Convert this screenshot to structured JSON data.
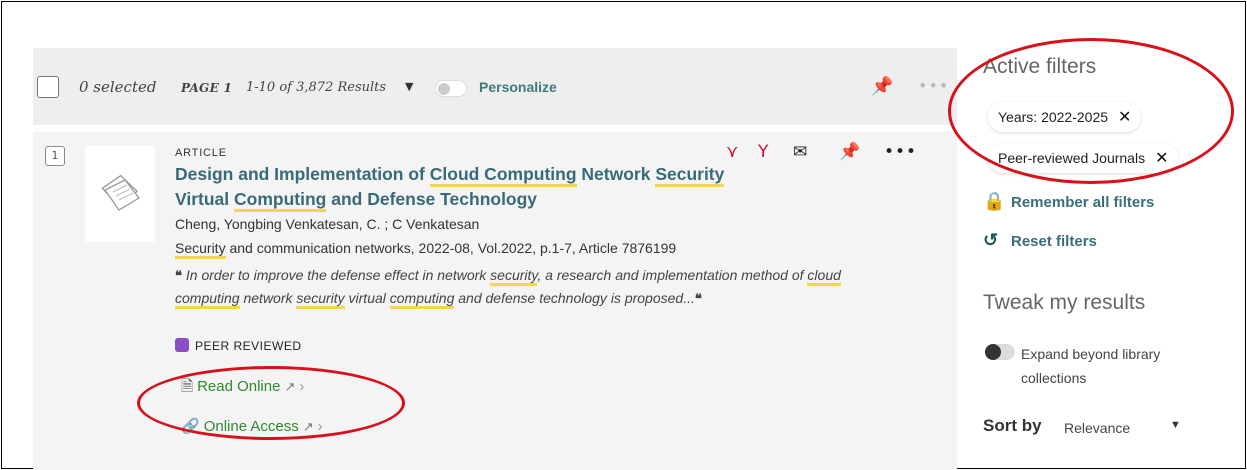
{
  "toolbar": {
    "selected": "0 selected",
    "page": "PAGE 1",
    "results": "1-10 of 3,872 Results",
    "personalize": "Personalize"
  },
  "result": {
    "number": "1",
    "type": "ARTICLE",
    "title_parts": [
      "Design and Implementation of ",
      "Cloud Computing",
      " Network ",
      "Security",
      " Virtual ",
      "Computing",
      " and Defense Technology"
    ],
    "authors": "Cheng, Yongbing Venkatesan, C. ; C Venkatesan",
    "source_hl": "Security",
    "source_rest": " and communication networks, 2022-08, Vol.2022, p.1-7, Article 7876199",
    "snippet_parts": [
      "In order to improve the defense effect in network ",
      "security",
      ", a research and implementation method of ",
      "cloud computing",
      " network ",
      "security",
      " virtual ",
      "computing",
      " and defense technology is proposed..."
    ],
    "peer_reviewed": "PEER REVIEWED",
    "read_online": "Read Online",
    "online_access": "Online Access"
  },
  "sidebar": {
    "active_filters_title": "Active filters",
    "chips": [
      "Years: 2022-2025",
      "Peer-reviewed Journals"
    ],
    "remember": "Remember all filters",
    "reset": "Reset filters",
    "tweak_title": "Tweak my results",
    "expand_label": "Expand beyond library collections",
    "sort_label": "Sort by",
    "sort_value": "Relevance"
  },
  "colors": {
    "accent_teal": "#386a78",
    "link_green": "#2e8b2e",
    "highlight": "#f3d64c",
    "annotation_red": "#d8101a"
  }
}
